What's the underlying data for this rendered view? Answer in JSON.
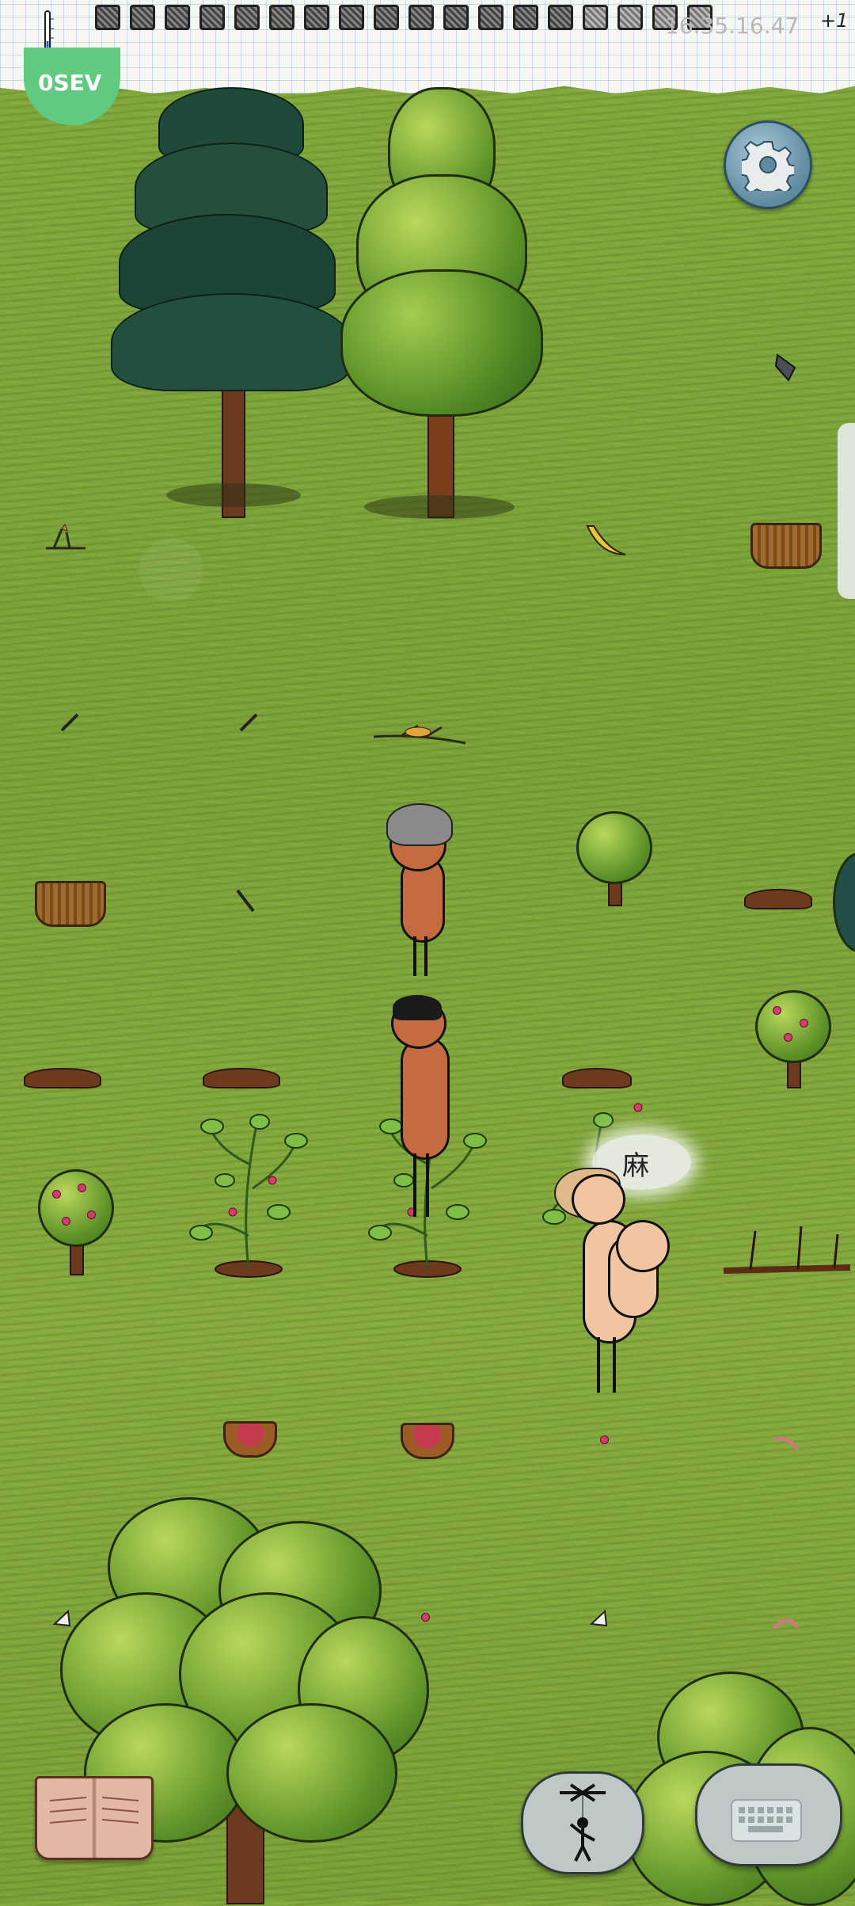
{
  "hud": {
    "faded_text": "16.35.16.47",
    "bonus": "+1",
    "age_badge": "0SEV",
    "food_slots_filled": 14,
    "food_slots_total": 18
  },
  "player": {
    "speech": "麻"
  },
  "icons": {
    "settings": "gear-icon",
    "book": "book-icon",
    "emote": "puppet-icon",
    "keyboard": "keyboard-icon",
    "temperature": "thermometer-icon"
  },
  "colors": {
    "grass": "#7ba23a",
    "age_badge": "#5fca80",
    "settings": "#5f8aa0"
  }
}
